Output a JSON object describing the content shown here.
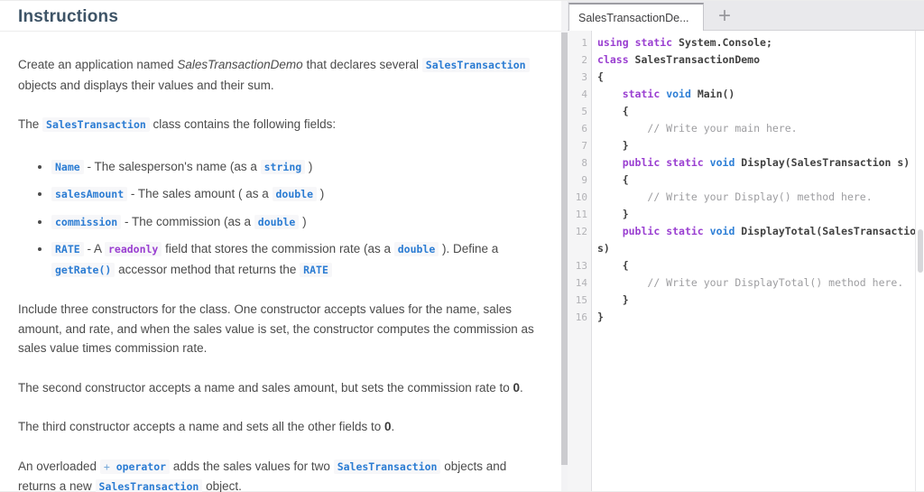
{
  "colors": {
    "title": "#3e5467",
    "inline_code_blue": "#2b7cd3",
    "keyword_purple": "#9a3fd1",
    "type_blue": "#2e7fd6",
    "comment_gray": "#9d9da0"
  },
  "instructions": {
    "title": "Instructions",
    "blocks": [
      {
        "type": "p",
        "segments": [
          {
            "t": "Create an application named ",
            "s": "plain"
          },
          {
            "t": "SalesTransactionDemo",
            "s": "em"
          },
          {
            "t": " that declares several ",
            "s": "plain"
          },
          {
            "t": "SalesTransaction",
            "s": "code"
          },
          {
            "t": " objects and displays their values and their sum.",
            "s": "plain"
          }
        ]
      },
      {
        "type": "p",
        "segments": [
          {
            "t": "The ",
            "s": "plain"
          },
          {
            "t": "SalesTransaction",
            "s": "code"
          },
          {
            "t": " class contains the following fields:",
            "s": "plain"
          }
        ]
      },
      {
        "type": "ul",
        "items": [
          {
            "segments": [
              {
                "t": "Name",
                "s": "code"
              },
              {
                "t": " - The salesperson's name (as a ",
                "s": "plain"
              },
              {
                "t": "string",
                "s": "code"
              },
              {
                "t": " )",
                "s": "plain"
              }
            ]
          },
          {
            "segments": [
              {
                "t": "salesAmount",
                "s": "code"
              },
              {
                "t": " - The sales amount ( as a ",
                "s": "plain"
              },
              {
                "t": "double",
                "s": "code"
              },
              {
                "t": " )",
                "s": "plain"
              }
            ]
          },
          {
            "segments": [
              {
                "t": "commission",
                "s": "code"
              },
              {
                "t": " - The commission (as a ",
                "s": "plain"
              },
              {
                "t": "double",
                "s": "code"
              },
              {
                "t": " )",
                "s": "plain"
              }
            ]
          },
          {
            "segments": [
              {
                "t": "RATE",
                "s": "code"
              },
              {
                "t": " - A ",
                "s": "plain"
              },
              {
                "t": "readonly",
                "s": "code-kw"
              },
              {
                "t": " field that stores the commission rate (as a ",
                "s": "plain"
              },
              {
                "t": "double",
                "s": "code"
              },
              {
                "t": " ). Define a ",
                "s": "plain"
              },
              {
                "t": "getRate()",
                "s": "code"
              },
              {
                "t": " accessor method that returns the ",
                "s": "plain"
              },
              {
                "t": "RATE",
                "s": "code"
              }
            ]
          }
        ]
      },
      {
        "type": "p",
        "segments": [
          {
            "t": "Include three constructors for the class. One constructor accepts values for the name, sales amount, and rate, and when the sales value is set, the constructor computes the commission as sales value times commission rate.",
            "s": "plain"
          }
        ]
      },
      {
        "type": "p",
        "segments": [
          {
            "t": "The second constructor accepts a name and sales amount, but sets the commission rate to ",
            "s": "plain"
          },
          {
            "t": "0",
            "s": "b"
          },
          {
            "t": ".",
            "s": "plain"
          }
        ]
      },
      {
        "type": "p",
        "segments": [
          {
            "t": "The third constructor accepts a name and sets all the other fields to ",
            "s": "plain"
          },
          {
            "t": "0",
            "s": "b"
          },
          {
            "t": ".",
            "s": "plain"
          }
        ]
      },
      {
        "type": "p",
        "segments": [
          {
            "t": "An overloaded ",
            "s": "plain"
          },
          {
            "s": "group",
            "parts": [
              {
                "t": "+",
                "c": "lt"
              },
              {
                "t": " operator",
                "c": "b"
              }
            ]
          },
          {
            "t": " adds the sales values for two ",
            "s": "plain"
          },
          {
            "t": "SalesTransaction",
            "s": "code"
          },
          {
            "t": " objects and returns a new ",
            "s": "plain"
          },
          {
            "t": "SalesTransaction",
            "s": "code"
          },
          {
            "t": " object.",
            "s": "plain"
          }
        ]
      }
    ]
  },
  "editor": {
    "tab_label": "SalesTransactionDe...",
    "new_tab_icon": "+",
    "lines": [
      {
        "n": "1",
        "segments": [
          {
            "t": "using",
            "c": "kw"
          },
          {
            "t": " ",
            "c": "pl"
          },
          {
            "t": "static",
            "c": "kw"
          },
          {
            "t": " System.Console;",
            "c": "pl"
          }
        ]
      },
      {
        "n": "2",
        "segments": [
          {
            "t": "class",
            "c": "kw"
          },
          {
            "t": " SalesTransactionDemo",
            "c": "pl"
          }
        ]
      },
      {
        "n": "3",
        "segments": [
          {
            "t": "{",
            "c": "pl"
          }
        ]
      },
      {
        "n": "4",
        "segments": [
          {
            "t": "    ",
            "c": "pl"
          },
          {
            "t": "static",
            "c": "kw"
          },
          {
            "t": " ",
            "c": "pl"
          },
          {
            "t": "void",
            "c": "ty"
          },
          {
            "t": " Main()",
            "c": "pl"
          }
        ]
      },
      {
        "n": "5",
        "segments": [
          {
            "t": "    {",
            "c": "pl"
          }
        ]
      },
      {
        "n": "6",
        "segments": [
          {
            "t": "        // Write your main here.",
            "c": "cm"
          }
        ]
      },
      {
        "n": "7",
        "segments": [
          {
            "t": "    }",
            "c": "pl"
          }
        ]
      },
      {
        "n": "8",
        "segments": [
          {
            "t": "    ",
            "c": "pl"
          },
          {
            "t": "public",
            "c": "kw"
          },
          {
            "t": " ",
            "c": "pl"
          },
          {
            "t": "static",
            "c": "kw"
          },
          {
            "t": " ",
            "c": "pl"
          },
          {
            "t": "void",
            "c": "ty"
          },
          {
            "t": " Display(SalesTransaction s)",
            "c": "pl"
          }
        ]
      },
      {
        "n": "9",
        "segments": [
          {
            "t": "    {",
            "c": "pl"
          }
        ]
      },
      {
        "n": "10",
        "segments": [
          {
            "t": "        // Write your Display() method here.",
            "c": "cm"
          }
        ]
      },
      {
        "n": "11",
        "segments": [
          {
            "t": "    }",
            "c": "pl"
          }
        ]
      },
      {
        "n": "12",
        "segments": [
          {
            "t": "    ",
            "c": "pl"
          },
          {
            "t": "public",
            "c": "kw"
          },
          {
            "t": " ",
            "c": "pl"
          },
          {
            "t": "static",
            "c": "kw"
          },
          {
            "t": " ",
            "c": "pl"
          },
          {
            "t": "void",
            "c": "ty"
          },
          {
            "t": " DisplayTotal(SalesTransaction s)",
            "c": "pl"
          }
        ]
      },
      {
        "n": "13",
        "segments": [
          {
            "t": "    {",
            "c": "pl"
          }
        ]
      },
      {
        "n": "14",
        "segments": [
          {
            "t": "        // Write your DisplayTotal() method here.",
            "c": "cm"
          }
        ]
      },
      {
        "n": "15",
        "segments": [
          {
            "t": "    }",
            "c": "pl"
          }
        ]
      },
      {
        "n": "16",
        "segments": [
          {
            "t": "}",
            "c": "pl"
          }
        ]
      }
    ]
  }
}
